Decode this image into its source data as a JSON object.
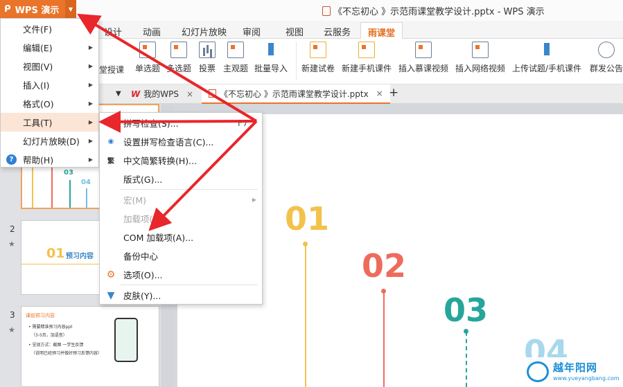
{
  "app": {
    "menu_button": "WPS 演示",
    "window_title": "《不忘初心 》示范雨课堂教学设计.pptx - WPS 演示"
  },
  "ribbon_tabs": [
    "设计",
    "动画",
    "幻灯片放映",
    "审阅",
    "视图",
    "云服务",
    "雨课堂"
  ],
  "ribbon_buttons": [
    {
      "label": "堂授课"
    },
    {
      "label": "单选题"
    },
    {
      "label": "多选题"
    },
    {
      "label": "投票"
    },
    {
      "label": "主观题"
    },
    {
      "label": "批量导入"
    },
    {
      "label": "新建试卷"
    },
    {
      "label": "新建手机课件"
    },
    {
      "label": "插入慕课视频"
    },
    {
      "label": "插入网络视频"
    },
    {
      "label": "上传试题/手机课件"
    },
    {
      "label": "群发公告"
    }
  ],
  "doc_tabs": {
    "home": "我的WPS",
    "document": "《不忘初心 》示范雨课堂教学设计.pptx",
    "close": "×",
    "add": "+"
  },
  "main_menu": [
    {
      "label": "文件(F)",
      "arrow": false
    },
    {
      "label": "编辑(E)",
      "arrow": true
    },
    {
      "label": "视图(V)",
      "arrow": true
    },
    {
      "label": "插入(I)",
      "arrow": true
    },
    {
      "label": "格式(O)",
      "arrow": true
    },
    {
      "label": "工具(T)",
      "arrow": true
    },
    {
      "label": "幻灯片放映(D)",
      "arrow": true
    },
    {
      "label": "帮助(H)",
      "arrow": true
    }
  ],
  "tools_submenu": [
    {
      "label": "拼写检查(S)...",
      "shortcut": "F7"
    },
    {
      "label": "设置拼写检查语言(C)..."
    },
    {
      "label": "中文简繁转换(H)..."
    },
    {
      "label": "版式(G)..."
    },
    {
      "label": "宏(M)",
      "disabled": true
    },
    {
      "label": "加载项(I)...",
      "disabled": true
    },
    {
      "label": "COM 加载项(A)..."
    },
    {
      "label": "备份中心"
    },
    {
      "label": "选项(O)..."
    },
    {
      "label": "皮肤(Y)..."
    }
  ],
  "slides": [
    {
      "number": "1",
      "labels": [
        "03",
        "04"
      ]
    },
    {
      "number": "2",
      "num": "01",
      "title": "预习内容"
    },
    {
      "number": "3",
      "heading": "课前预习内容",
      "bullets": [
        "• 需要精准预习内容ppt",
        "（3-5页，加语音）",
        "• 呈现方式：截图 一学生反馈",
        "（说明已经预习并做好预习反馈内容）"
      ]
    }
  ],
  "slide_numbers": [
    {
      "text": "01",
      "color": "#f2c24b"
    },
    {
      "text": "02",
      "color": "#ee6b5b"
    },
    {
      "text": "03",
      "color": "#26a69a"
    },
    {
      "text": "04",
      "color": "#6fbfe0"
    }
  ],
  "watermark": {
    "text": "越年阳网",
    "url": "www.yueyangbang.com"
  },
  "colors": {
    "accent": "#e9742a",
    "active_tab": "#e27020",
    "annotation_arrow": "#e8262b"
  }
}
